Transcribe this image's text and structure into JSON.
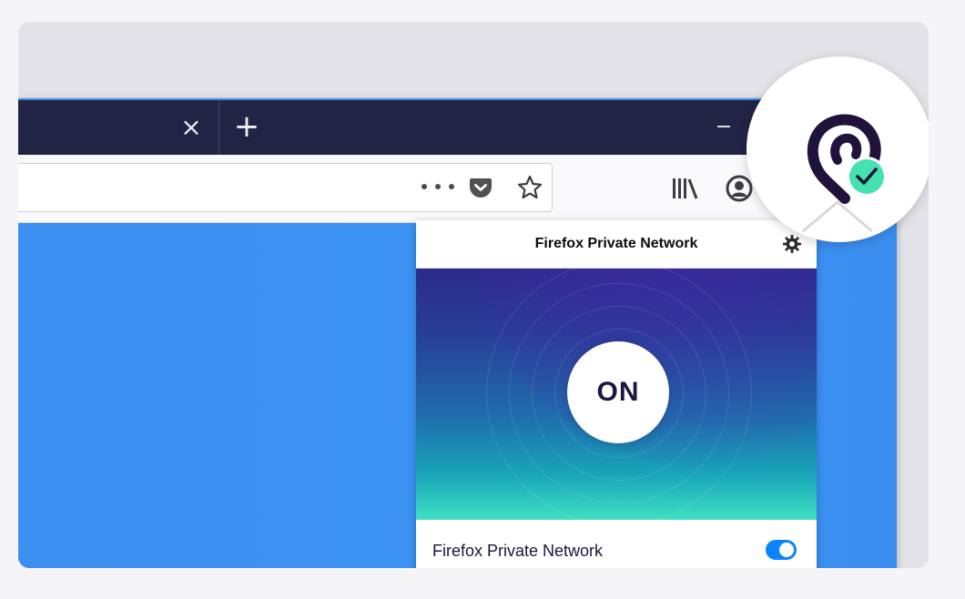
{
  "browser": {
    "tab_close_glyph": "×",
    "new_tab_glyph": "+",
    "theme_color": "#212445",
    "toolbar_icons": [
      "page-actions-icon",
      "pocket-icon",
      "bookmark-star-icon",
      "library-icon",
      "account-icon"
    ]
  },
  "vpn_popup": {
    "title": "Firefox Private Network",
    "settings_icon": "gear-icon",
    "status_button_label": "ON",
    "toggle_label": "Firefox Private Network",
    "toggle_state": "on",
    "accent_color": "#0a84ff"
  },
  "toolbar_extension": {
    "icon": "private-network-logo-icon",
    "badge": "check-icon",
    "badge_color": "#45e2b0"
  }
}
